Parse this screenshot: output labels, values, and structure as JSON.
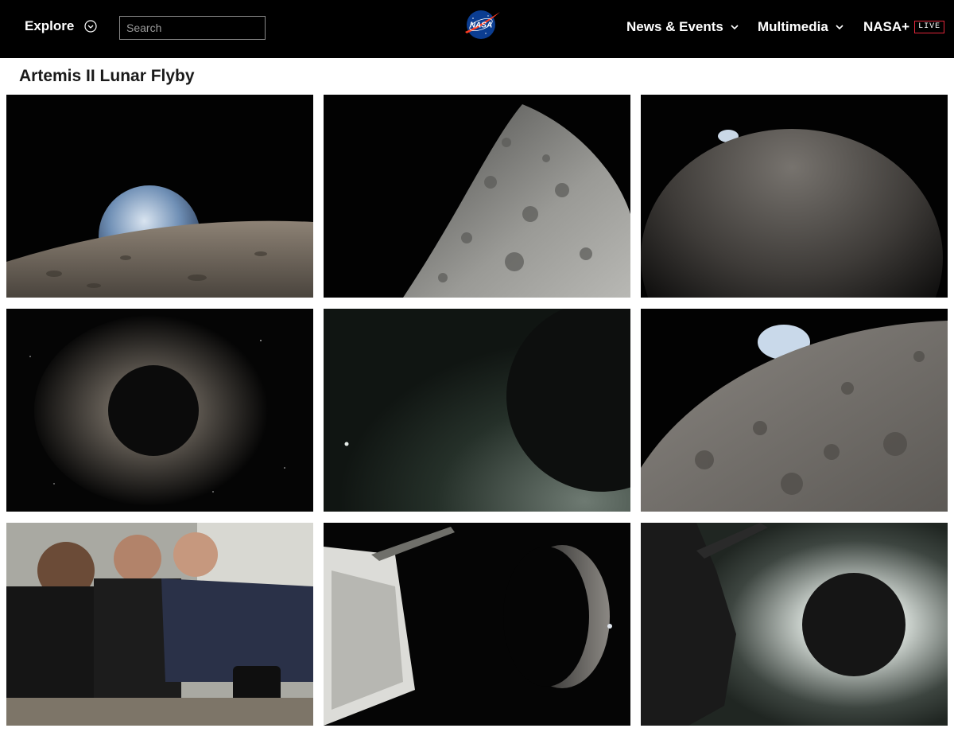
{
  "header": {
    "explore_label": "Explore",
    "search_placeholder": "Search",
    "logo_text": "NASA",
    "nav": [
      {
        "label": "News & Events",
        "icon": "chevron-down-icon"
      },
      {
        "label": "Multimedia",
        "icon": "chevron-down-icon"
      },
      {
        "label": "NASA+",
        "badge": "LIVE"
      }
    ]
  },
  "page": {
    "title": "Artemis II Lunar Flyby"
  },
  "gallery": {
    "images": [
      "earthrise-over-lunar-horizon",
      "cratered-lunar-limb-closeup",
      "earth-peeking-over-moon",
      "solar-eclipse-corona-behind-moon",
      "dark-moon-silhouette-with-glow",
      "earthset-over-cratered-surface",
      "crew-looking-through-window",
      "orion-spacecraft-and-crescent-moon",
      "eclipse-glow-beside-spacecraft"
    ]
  },
  "colors": {
    "header_bg": "#000000",
    "live_badge": "#e0263a",
    "nasa_blue": "#0b3d91",
    "nasa_red": "#fc3d21"
  }
}
